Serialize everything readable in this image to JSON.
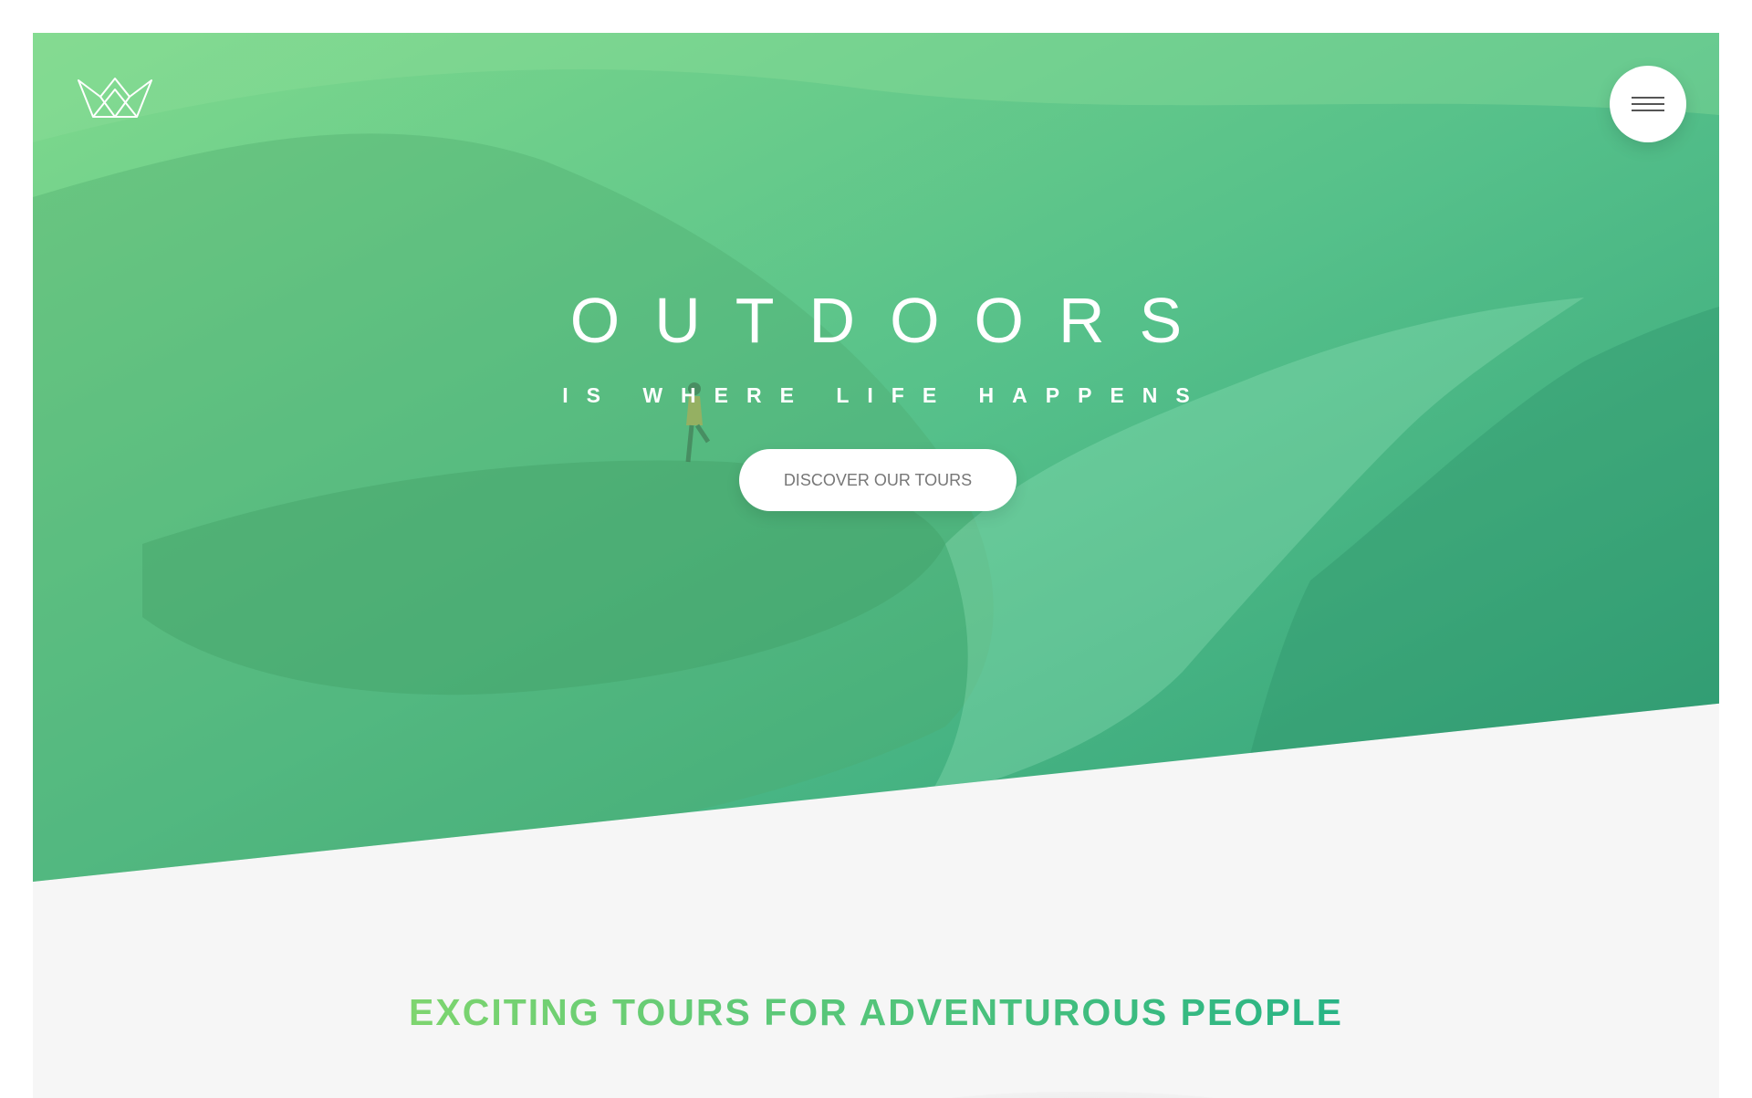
{
  "brand": {
    "logo_icon": "crown-logo-icon"
  },
  "header": {
    "menu_icon": "hamburger-menu-icon"
  },
  "hero": {
    "title": "OUTDOORS",
    "subtitle": "IS WHERE LIFE HAPPENS",
    "cta_label": "DISCOVER OUR TOURS",
    "overlay_colors": [
      "#7ed56f",
      "#28b485"
    ]
  },
  "section": {
    "heading": "EXCITING TOURS FOR ADVENTUROUS PEOPLE",
    "background": "#f7f7f7"
  }
}
